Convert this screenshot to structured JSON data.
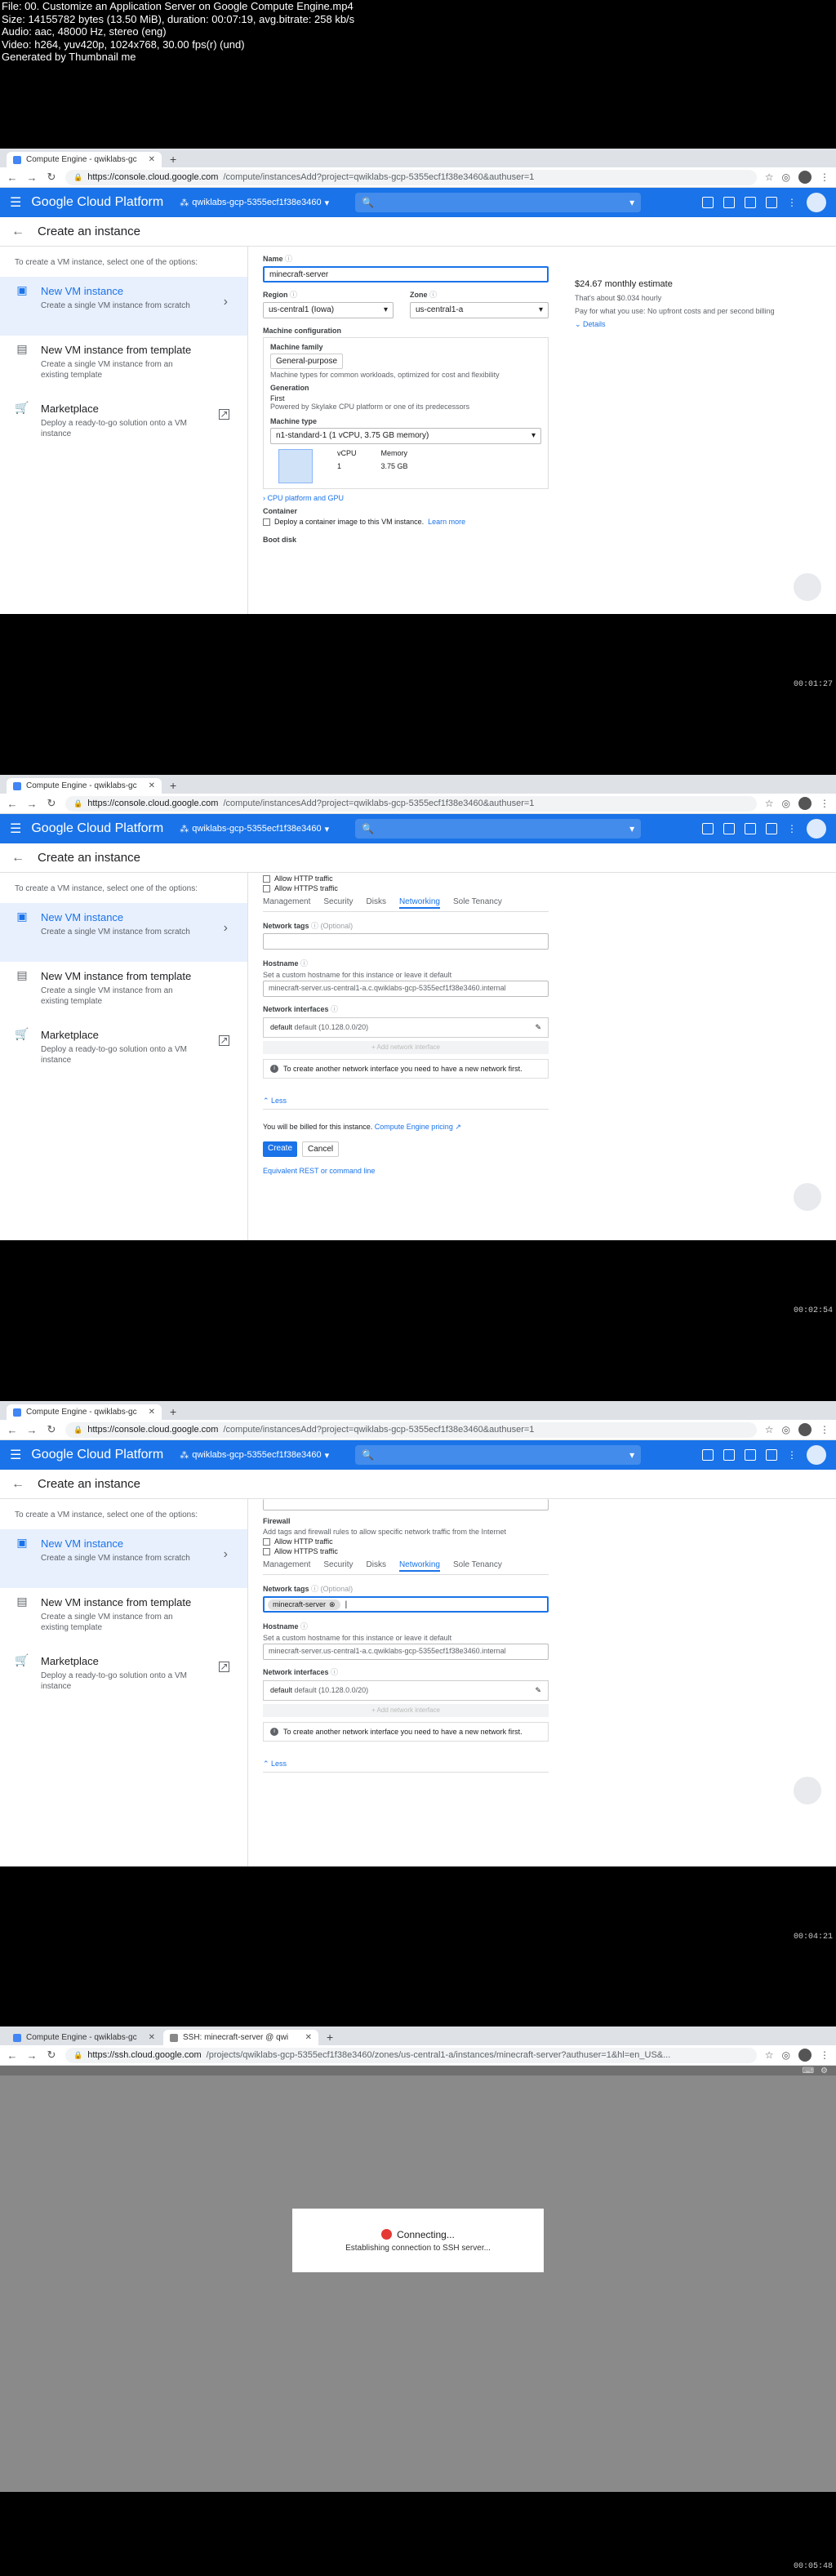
{
  "header": {
    "lines": [
      "File: 00. Customize an Application Server on Google Compute Engine.mp4",
      "Size: 14155782 bytes (13.50 MiB), duration: 00:07:19, avg.bitrate: 258 kb/s",
      "Audio: aac, 48000 Hz, stereo (eng)",
      "Video: h264, yuv420p, 1024x768, 30.00 fps(r) (und)",
      "Generated by Thumbnail me"
    ]
  },
  "browser": {
    "tab1": "Compute Engine - qwiklabs-gc",
    "tab2": "SSH: minecraft-server @ qwi",
    "new_tab": "+",
    "url_host": "https://console.cloud.google.com",
    "url_path1": "/compute/instancesAdd?project=qwiklabs-gcp-5355ecf1f38e3460&authuser=1",
    "ssh_url_host": "https://ssh.cloud.google.com",
    "ssh_url_path": "/projects/qwiklabs-gcp-5355ecf1f38e3460/zones/us-central1-a/instances/minecraft-server?authuser=1&hl=en_US&..."
  },
  "gcp": {
    "title": "Google Cloud Platform",
    "project": "qwiklabs-gcp-5355ecf1f38e3460",
    "page_title": "Create an instance"
  },
  "left": {
    "hint": "To create a VM instance, select one of the options:",
    "options": [
      {
        "title": "New VM instance",
        "desc": "Create a single VM instance from scratch"
      },
      {
        "title": "New VM instance from template",
        "desc": "Create a single VM instance from an existing template"
      },
      {
        "title": "Marketplace",
        "desc": "Deploy a ready-to-go solution onto a VM instance"
      }
    ]
  },
  "frame1": {
    "name_label": "Name",
    "name_value": "minecraft-server",
    "region_label": "Region",
    "region_value": "us-central1 (Iowa)",
    "zone_label": "Zone",
    "zone_value": "us-central1-a",
    "machine_config": "Machine configuration",
    "machine_family": "Machine family",
    "family_value": "General-purpose",
    "family_desc": "Machine types for common workloads, optimized for cost and flexibility",
    "generation": "Generation",
    "generation_value": "First",
    "generation_desc": "Powered by Skylake CPU platform or one of its predecessors",
    "machine_type": "Machine type",
    "machine_type_value": "n1-standard-1 (1 vCPU, 3.75 GB memory)",
    "vcpu_label": "vCPU",
    "vcpu_value": "1",
    "memory_label": "Memory",
    "memory_value": "3.75 GB",
    "cpu_link": "CPU platform and GPU",
    "container": "Container",
    "container_desc": "Deploy a container image to this VM instance.",
    "learn_more": "Learn more",
    "boot_disk": "Boot disk",
    "estimate": "$24.67 monthly estimate",
    "hourly": "That's about $0.034 hourly",
    "pay": "Pay for what you use: No upfront costs and per second billing",
    "details": "Details",
    "timestamp": "00:01:27"
  },
  "frame2": {
    "allow_http": "Allow HTTP traffic",
    "allow_https": "Allow HTTPS traffic",
    "tabs": [
      "Management",
      "Security",
      "Disks",
      "Networking",
      "Sole Tenancy"
    ],
    "network_tags": "Network tags",
    "optional": "(Optional)",
    "hostname": "Hostname",
    "hostname_desc": "Set a custom hostname for this instance or leave it default",
    "hostname_placeholder": "minecraft-server.us-central1-a.c.qwiklabs-gcp-5355ecf1f38e3460.internal",
    "network_interfaces": "Network interfaces",
    "iface": "default",
    "iface_detail": "default (10.128.0.0/20)",
    "add_iface": "+ Add network interface",
    "info": "To create another network interface you need to have a new network first.",
    "less": "Less",
    "billing": "You will be billed for this instance.",
    "pricing": "Compute Engine pricing",
    "create": "Create",
    "cancel": "Cancel",
    "equivalent": "Equivalent REST or command line",
    "timestamp": "00:02:54"
  },
  "frame3": {
    "firewall": "Firewall",
    "firewall_desc": "Add tags and firewall rules to allow specific network traffic from the Internet",
    "tag_chip": "minecraft-server",
    "timestamp": "00:04:21"
  },
  "frame4": {
    "connecting": "Connecting...",
    "establishing": "Establishing connection to SSH server...",
    "timestamp": "00:05:48"
  }
}
